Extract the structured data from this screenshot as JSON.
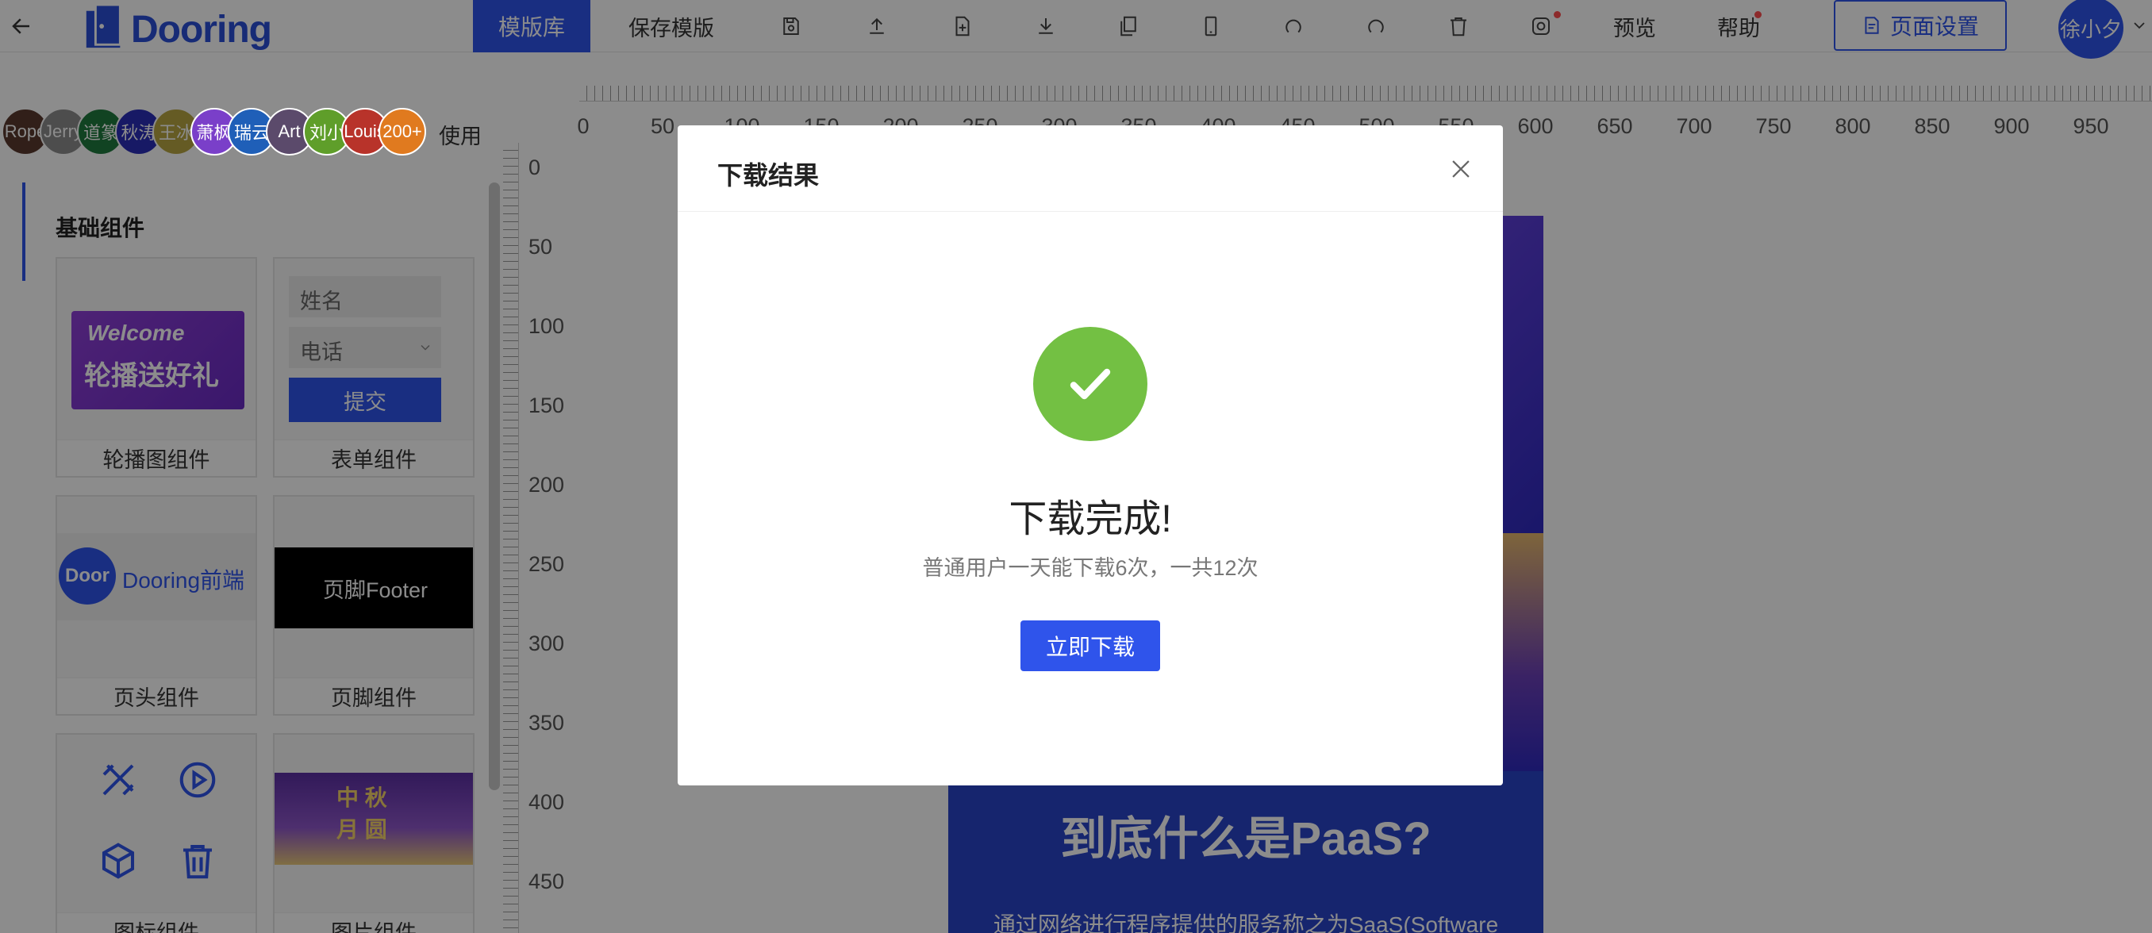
{
  "header": {
    "brand": "Dooring",
    "toolbar": {
      "template_library": "模版库",
      "save_template": "保存模版",
      "preview": "预览",
      "help": "帮助",
      "page_settings": "页面设置"
    },
    "user_name": "徐小夕"
  },
  "collaborators": [
    "Rope",
    "Jerry",
    "道篆",
    "秋涛",
    "王冰",
    "萧枫",
    "瑞云",
    "Art",
    "刘小",
    "Louis",
    "200+"
  ],
  "collaborator_colors": [
    "#5a3a2e",
    "#8c8c8c",
    "#1f7a3f",
    "#2a2fb8",
    "#b8a642",
    "#7a3fc9",
    "#1f5fb8",
    "#5b4a6b",
    "#5f9e2a",
    "#b8332a",
    "#e07a1f"
  ],
  "use_label": "使用",
  "sidebar": {
    "section_title": "基础组件",
    "cards": {
      "carousel": {
        "caption": "轮播图组件",
        "banner_line1": "Welcome",
        "banner_line2": "轮播送好礼"
      },
      "form": {
        "caption": "表单组件",
        "name_placeholder": "姓名",
        "phone_placeholder": "电话",
        "submit": "提交"
      },
      "header": {
        "caption": "页头组件",
        "logo_text": "Door",
        "title": "Dooring前端"
      },
      "footer": {
        "caption": "页脚组件",
        "text": "页脚Footer"
      },
      "icon": {
        "caption": "图标组件"
      },
      "image": {
        "caption": "图片组件",
        "text_line1": "中 秋",
        "text_line2": "月 圆"
      }
    }
  },
  "rulers": {
    "horizontal": [
      "0",
      "50",
      "100",
      "150",
      "200",
      "250",
      "300",
      "350",
      "400",
      "450",
      "500",
      "550",
      "600",
      "650",
      "700",
      "750",
      "800",
      "850",
      "900",
      "950"
    ],
    "vertical": [
      "0",
      "50",
      "100",
      "150",
      "200",
      "250",
      "300",
      "350",
      "400",
      "450"
    ]
  },
  "canvas": {
    "heading": "到底什么是PaaS?",
    "body": "通过网络进行程序提供的服务称之为SaaS(Software"
  },
  "modal": {
    "title": "下载结果",
    "heading": "下载完成!",
    "subtitle": "普通用户一天能下载6次，一共12次",
    "button": "立即下载"
  },
  "colors": {
    "primary": "#2f54eb",
    "success": "#73c043",
    "canvas": "#2944c9"
  }
}
